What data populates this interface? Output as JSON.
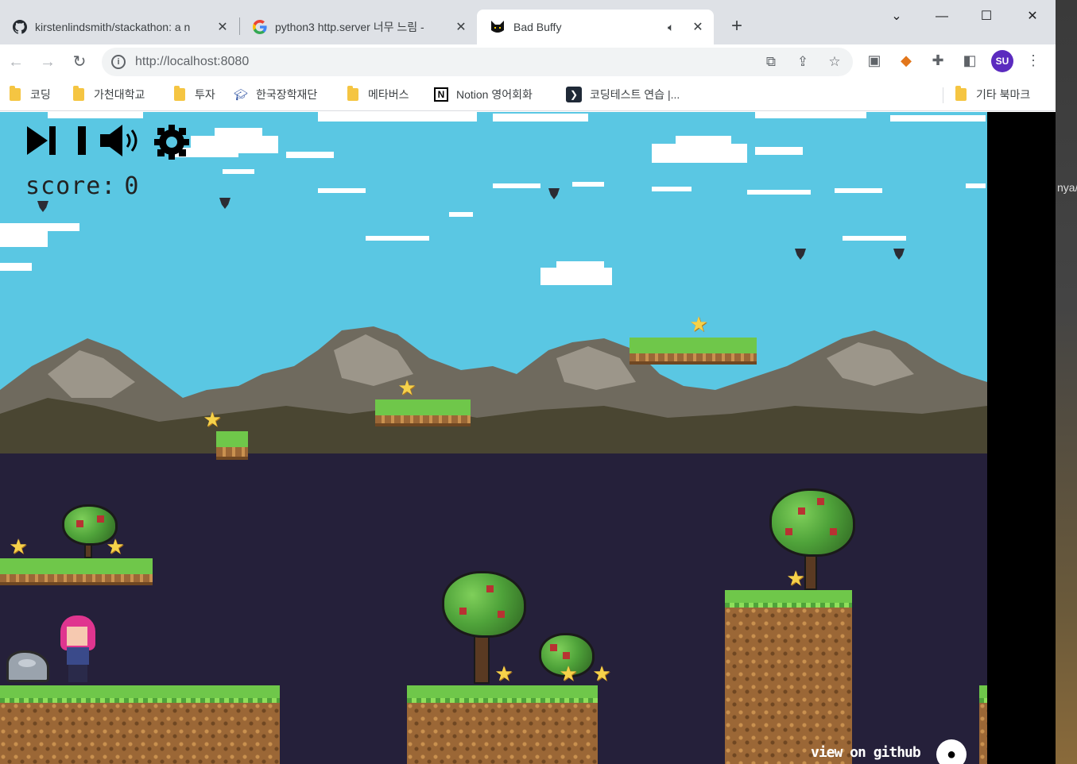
{
  "browser": {
    "tabs": [
      {
        "title": "kirstenlindsmith/stackathon: a n",
        "icon": "github-icon",
        "close": "✕"
      },
      {
        "title": "python3 http.server 너무 느림 -",
        "icon": "google-icon",
        "close": "✕"
      },
      {
        "title": "Bad Buffy",
        "icon": "cat-icon",
        "audio": "speaker-icon",
        "close": "✕"
      }
    ],
    "new_tab": "+",
    "window_controls": {
      "chevron": "⌄",
      "minimize": "—",
      "maximize": "☐",
      "close": "✕"
    },
    "url": "http://localhost:8080",
    "profile_initials": "SU",
    "bookmarks": [
      {
        "label": "코딩",
        "icon": "folder-icon"
      },
      {
        "label": "가천대학교",
        "icon": "folder-icon"
      },
      {
        "label": "투자",
        "icon": "folder-icon"
      },
      {
        "label": "한국장학재단",
        "icon": "graduation-cap-icon"
      },
      {
        "label": "메타버스",
        "icon": "folder-icon"
      },
      {
        "label": "Notion 영어회화",
        "icon": "notion-icon"
      },
      {
        "label": "코딩테스트 연습 |...",
        "icon": "code-icon"
      }
    ],
    "other_bookmarks": "기타 북마크"
  },
  "game": {
    "score_label": "score:",
    "score_value": "0",
    "github_link": "view on github",
    "hud": [
      "play-icon",
      "pause-icon",
      "sound-icon",
      "settings-icon"
    ],
    "colors": {
      "sky": "#5ac7e3",
      "ground_dark": "#25203a",
      "grass": "#6fc74a",
      "dirt": "#9b6736",
      "star": "#f6d24a"
    }
  },
  "desktop": {
    "peek_text": "nya/"
  }
}
